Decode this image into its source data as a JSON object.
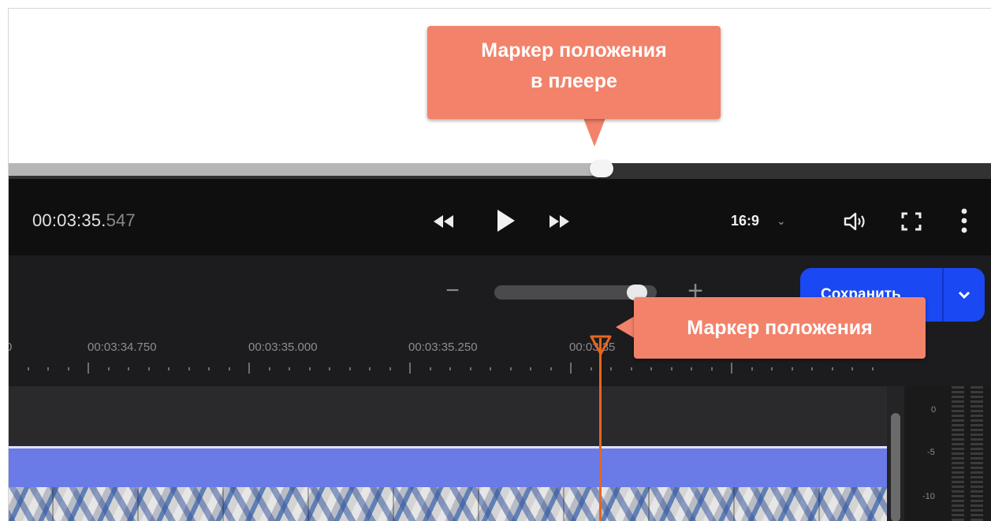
{
  "player": {
    "timecode_main": "00:03:35.",
    "timecode_ms": "547",
    "aspect_ratio": "16:9",
    "seek_progress": 0.61
  },
  "toolbar": {
    "zoom_out_symbol": "−",
    "zoom_in_symbol": "+",
    "zoom_level": 0.86,
    "save_label": "Сохранить"
  },
  "ruler": {
    "labels": [
      "0",
      "00:03:34.750",
      "00:03:35.000",
      "00:03:35.250",
      "00:03:35"
    ]
  },
  "meters": {
    "labels": [
      "0",
      "-5",
      "-10"
    ]
  },
  "callouts": {
    "player_marker_line1": "Маркер положения",
    "player_marker_line2": "в плеере",
    "timeline_marker": "Маркер положения"
  },
  "colors": {
    "accent_blue": "#1a48f2",
    "callout": "#f3826a",
    "playhead": "#e5661f",
    "audio_clip": "#6a7ae6"
  },
  "icons": {
    "rewind": "rewind-icon",
    "play": "play-icon",
    "forward": "fast-forward-icon",
    "volume": "volume-icon",
    "fullscreen": "fullscreen-icon",
    "more": "more-vertical-icon",
    "dropdown": "chevron-down-icon"
  }
}
